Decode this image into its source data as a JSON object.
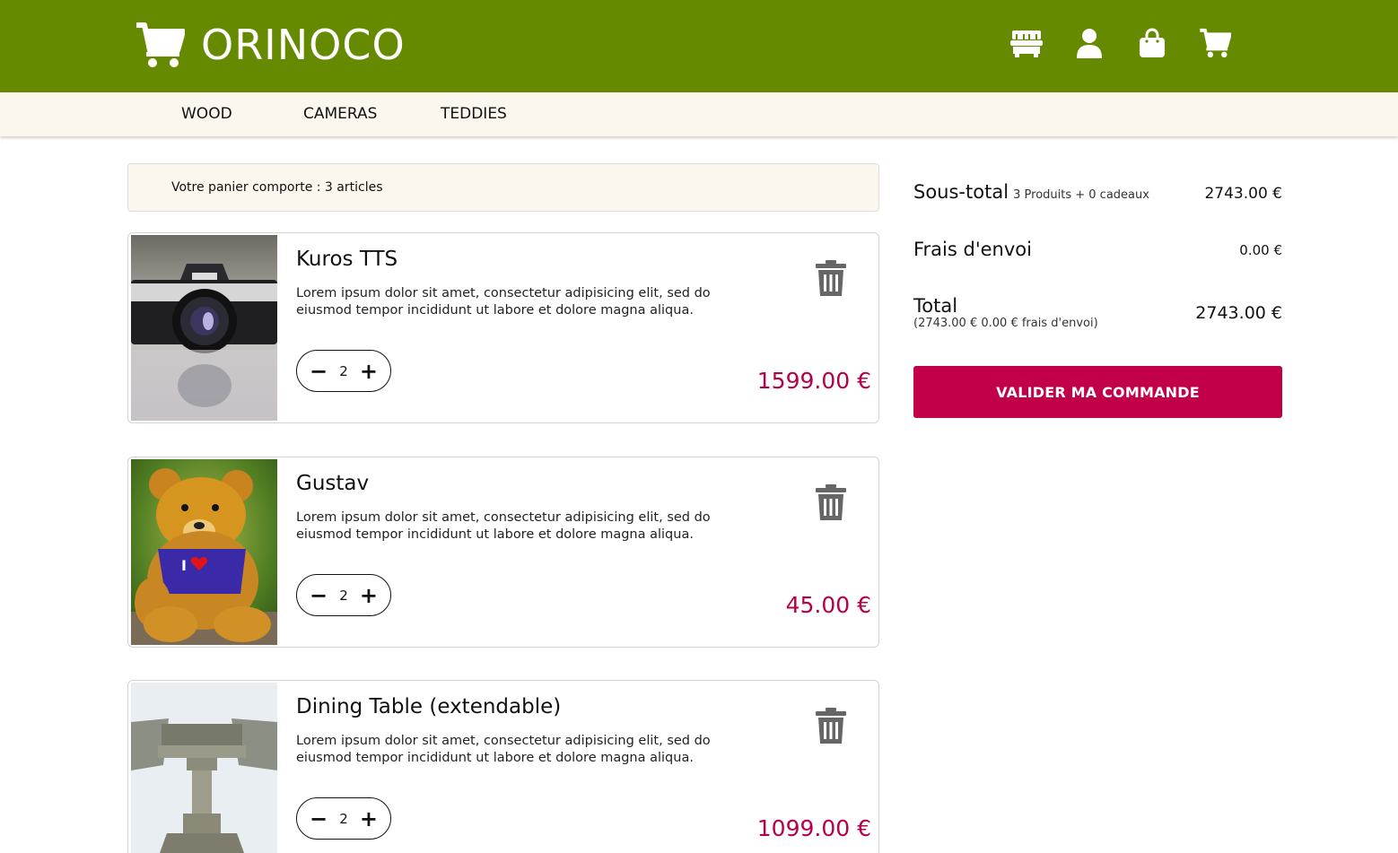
{
  "header": {
    "brand": "ORINOCO",
    "icons": [
      "store-icon",
      "user-icon",
      "shopping-bag-icon",
      "cart-icon"
    ]
  },
  "categories": [
    "WOOD",
    "CAMERAS",
    "TEDDIES"
  ],
  "cart_summary_text": "Votre panier comporte : 3 articles",
  "items": [
    {
      "name": "Kuros TTS",
      "description": "Lorem ipsum dolor sit amet, consectetur adipisicing elit, sed do eiusmod tempor incididunt ut labore et dolore magna aliqua.",
      "quantity": "2",
      "price": "1599.00 €",
      "image": "camera-image"
    },
    {
      "name": "Gustav",
      "description": "Lorem ipsum dolor sit amet, consectetur adipisicing elit, sed do eiusmod tempor incididunt ut labore et dolore magna aliqua.",
      "quantity": "2",
      "price": "45.00 €",
      "image": "teddy-bear-image"
    },
    {
      "name": "Dining Table (extendable)",
      "description": "Lorem ipsum dolor sit amet, consectetur adipisicing elit, sed do eiusmod tempor incididunt ut labore et dolore magna aliqua.",
      "quantity": "2",
      "price": "1099.00 €",
      "image": "table-image"
    }
  ],
  "qty_controls": {
    "minus": "−",
    "plus": "+"
  },
  "summary": {
    "subtotal_label": "Sous-total",
    "subtotal_detail": "3 Produits + 0 cadeaux",
    "subtotal_value": "2743.00 €",
    "shipping_label": "Frais d'envoi",
    "shipping_value": "0.00 €",
    "total_label": "Total",
    "total_detail": "(2743.00 € 0.00 € frais d'envoi)",
    "total_value": "2743.00 €",
    "order_button": "VALIDER MA COMMANDE"
  },
  "colors": {
    "header_green": "#658a00",
    "category_bar": "#fcf7ee",
    "price_accent": "#b5004b",
    "button_accent": "#c20049"
  }
}
